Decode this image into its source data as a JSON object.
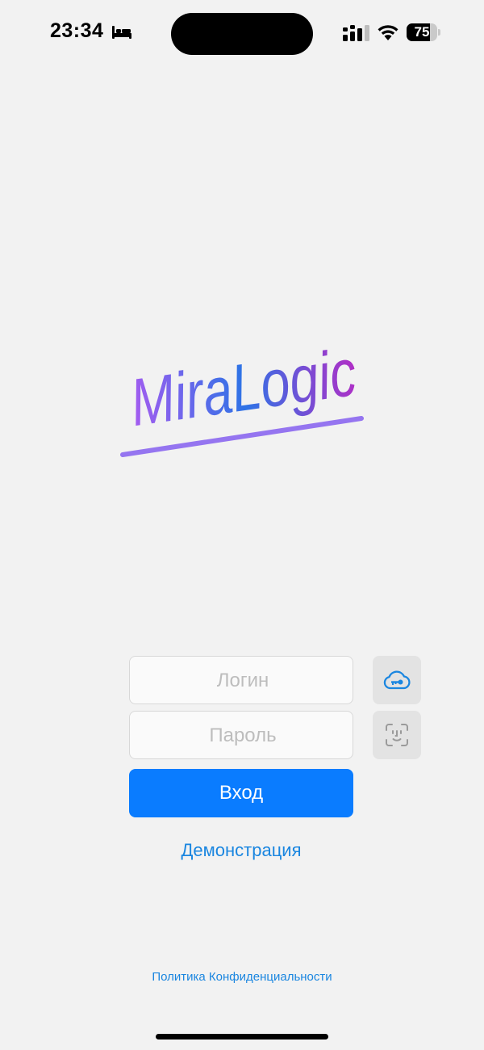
{
  "status_bar": {
    "time": "23:34",
    "battery_percent": "75",
    "battery_level": 0.75,
    "icons": [
      "bed-icon",
      "signal-icon",
      "wifi-icon",
      "battery-icon"
    ]
  },
  "logo": {
    "text": "MiraLogic",
    "gradient_start": "#a45cf0",
    "gradient_mid": "#2f73e6",
    "gradient_end": "#b02fc6",
    "underline_color": "#9575f0"
  },
  "form": {
    "login_placeholder": "Логин",
    "login_value": "",
    "password_placeholder": "Пароль",
    "password_value": "",
    "submit_label": "Вход",
    "submit_color": "#0a7cff",
    "cloud_key_icon": "cloud-key-icon",
    "face_id_icon": "face-id-icon"
  },
  "links": {
    "demo": "Демонстрация",
    "privacy": "Политика Конфиденциальности",
    "link_color": "#1a86e0"
  }
}
